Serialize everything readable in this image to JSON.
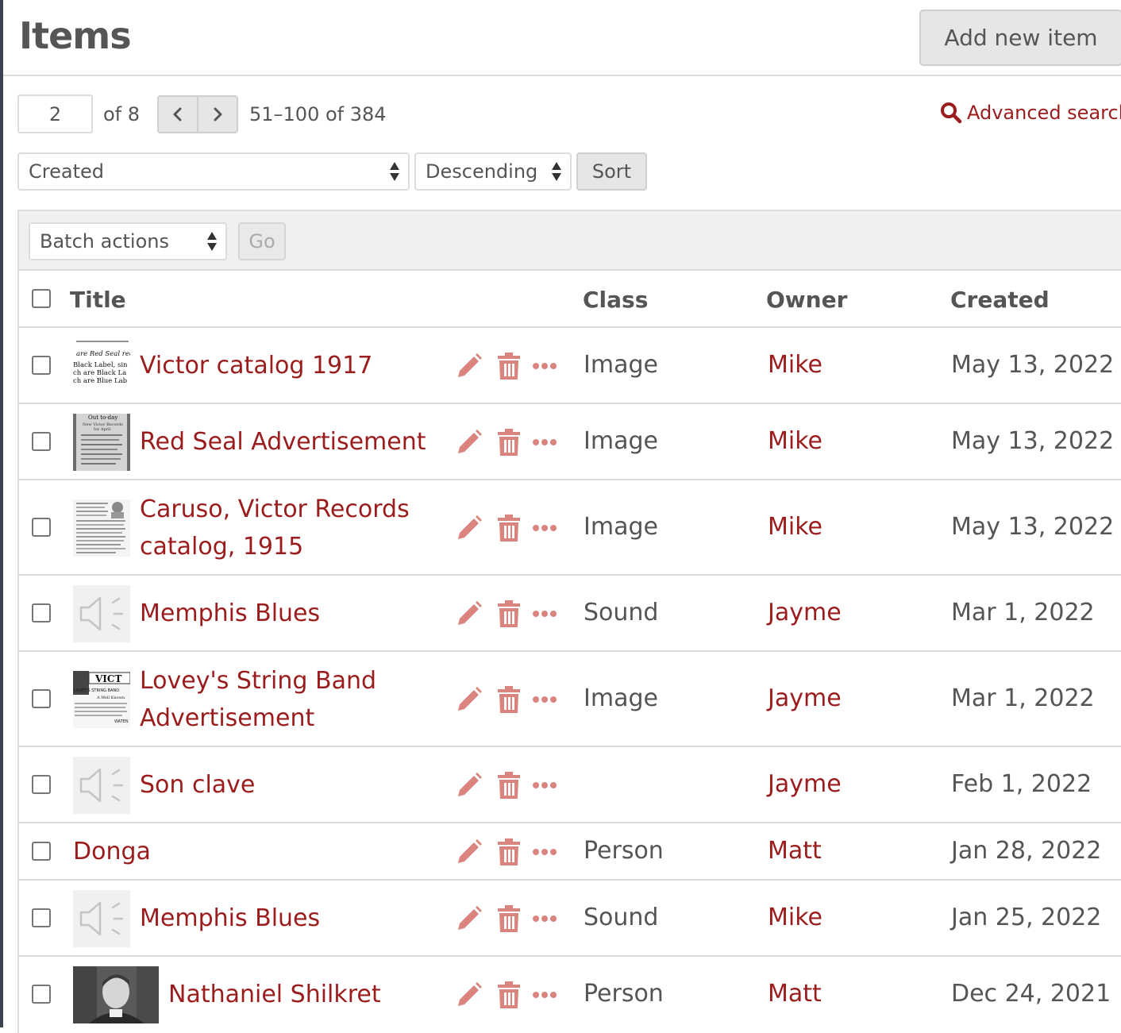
{
  "header": {
    "title": "Items",
    "add_button": "Add new item"
  },
  "pagination": {
    "current_page": "2",
    "of_pages": "of 8",
    "range": "51–100 of 384"
  },
  "advanced_search": "Advanced search",
  "sort": {
    "by": "Created",
    "order": "Descending",
    "button": "Sort"
  },
  "batch": {
    "select": "Batch actions",
    "go": "Go"
  },
  "columns": {
    "title": "Title",
    "class": "Class",
    "owner": "Owner",
    "created": "Created"
  },
  "rows": [
    {
      "title": "Victor catalog 1917",
      "class": "Image",
      "owner": "Mike",
      "created": "May 13, 2022",
      "thumb": "text-doc"
    },
    {
      "title": "Red Seal Advertisement",
      "class": "Image",
      "owner": "Mike",
      "created": "May 13, 2022",
      "thumb": "ad-doc"
    },
    {
      "title_line1": "Caruso, Victor Records",
      "title_line2": "catalog, 1915",
      "class": "Image",
      "owner": "Mike",
      "created": "May 13, 2022",
      "thumb": "catalog-doc"
    },
    {
      "title": "Memphis Blues",
      "class": "Sound",
      "owner": "Jayme",
      "created": "Mar 1, 2022",
      "thumb": "sound"
    },
    {
      "title_line1": "Lovey's String Band",
      "title_line2": "Advertisement",
      "class": "Image",
      "owner": "Jayme",
      "created": "Mar 1, 2022",
      "thumb": "victor-ad"
    },
    {
      "title": "Son clave",
      "class": "",
      "owner": "Jayme",
      "created": "Feb 1, 2022",
      "thumb": "sound"
    },
    {
      "title": "Donga",
      "class": "Person",
      "owner": "Matt",
      "created": "Jan 28, 2022",
      "thumb": ""
    },
    {
      "title": "Memphis Blues",
      "class": "Sound",
      "owner": "Mike",
      "created": "Jan 25, 2022",
      "thumb": "sound"
    },
    {
      "title": "Nathaniel Shilkret",
      "class": "Person",
      "owner": "Matt",
      "created": "Dec 24, 2021",
      "thumb": "portrait"
    }
  ],
  "thumb_text": {
    "victor_catalog": [
      "are Red Seal rec",
      "Black Label, sin",
      "ch are Black La",
      "ch are Blue Lab"
    ],
    "red_seal": [
      "Out to-day",
      "New Victor Records",
      "for April"
    ],
    "lovey": [
      "VICT",
      "LOVEY'S STRING BAND",
      "A Well Known",
      "WATEN"
    ]
  },
  "colors": {
    "accent": "#9b1c1c",
    "icon": "#d9847f",
    "border": "#dcdcdc"
  },
  "icons": {
    "edit": "pencil-icon",
    "delete": "trash-icon",
    "more": "ellipsis-icon",
    "search": "magnifier-icon",
    "prev": "chevron-left-icon",
    "next": "chevron-right-icon",
    "sound": "speaker-icon"
  }
}
